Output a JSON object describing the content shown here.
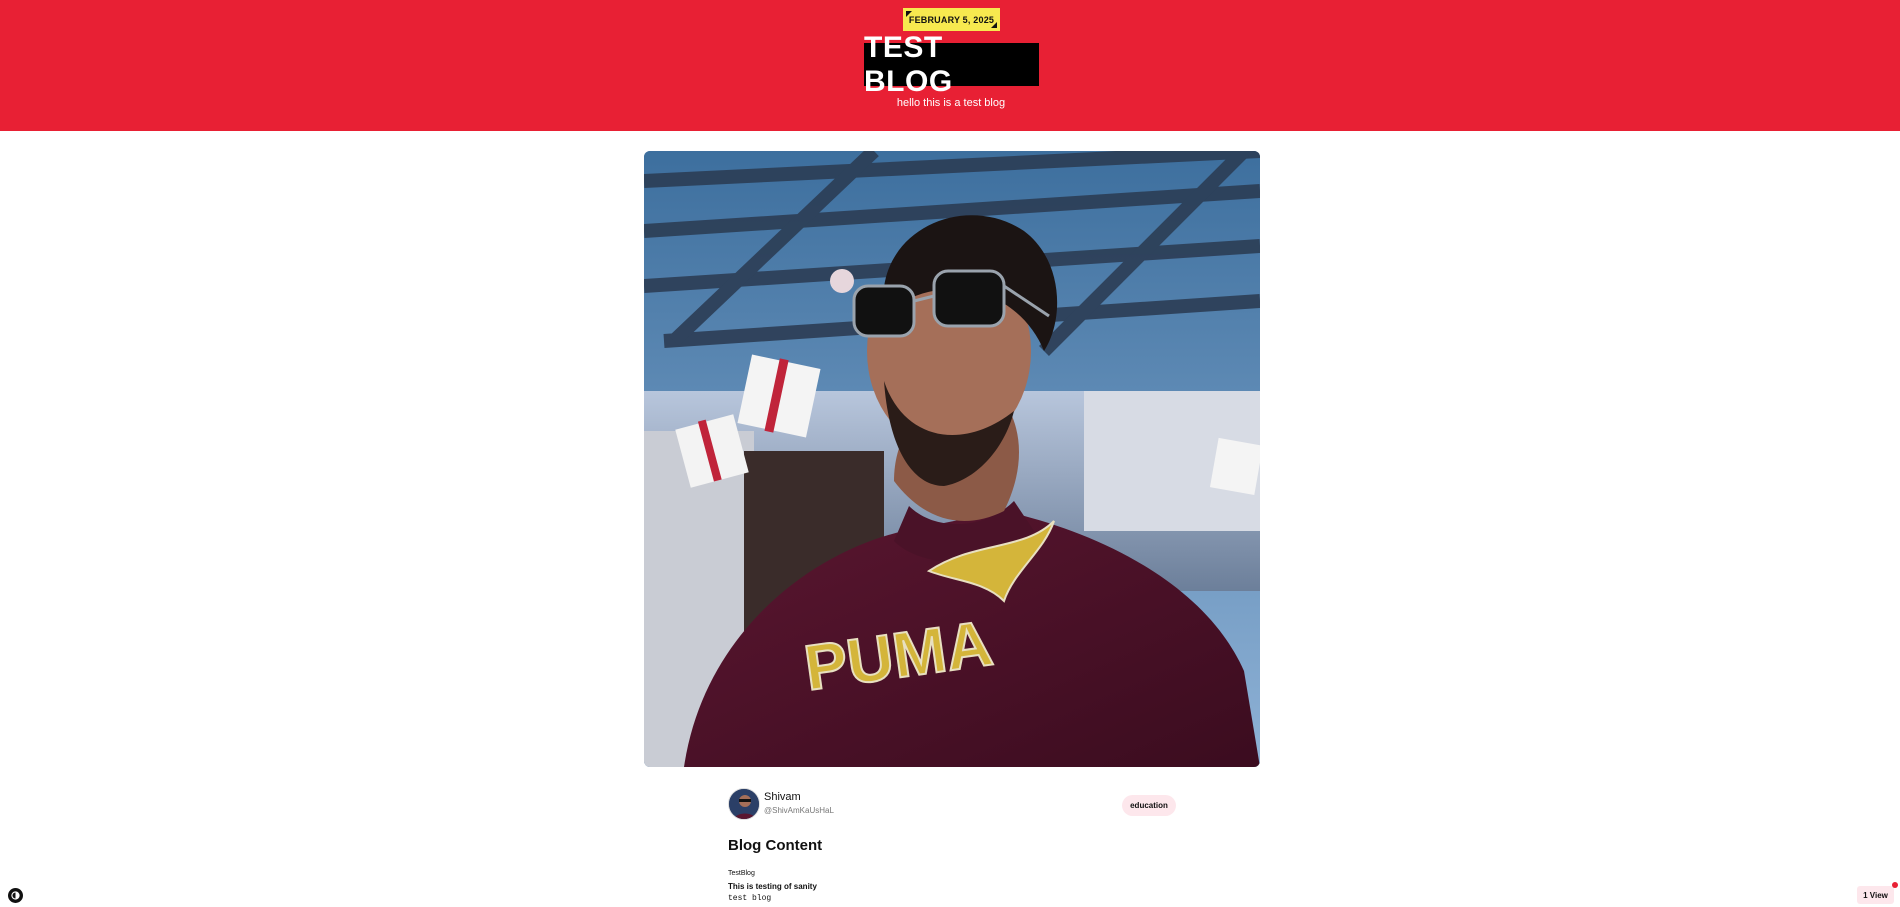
{
  "header": {
    "date": "FEBRUARY 5, 2025",
    "title": "TEST BLOG",
    "subtitle": "hello this is a test blog",
    "accent_color": "#e82034",
    "date_tag_color": "#f7e94f"
  },
  "cover": {
    "alt": "cover-photo",
    "hoodie_text": "PUMA"
  },
  "author": {
    "name": "Shivam",
    "handle": "@ShivAmKaUsHaL"
  },
  "tag": {
    "label": "education"
  },
  "content": {
    "heading": "Blog Content",
    "lines": [
      "TestBlog",
      "This is testing of sanity",
      "test blog"
    ]
  },
  "footer": {
    "views_label": "1 View",
    "theme_icon": "theme-toggle-icon"
  }
}
